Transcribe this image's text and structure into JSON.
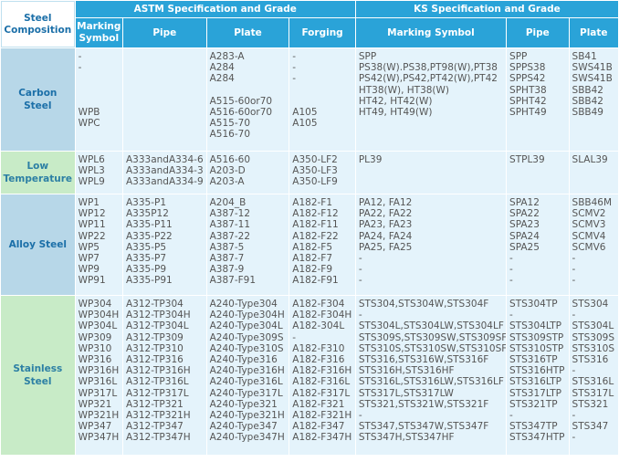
{
  "headers": {
    "composition": "Steel\nComposition",
    "astm_group": "ASTM Specification and Grade",
    "ks_group": "KS Specification and Grade",
    "astm_cols": [
      "Marking\nSymbol",
      "Pipe",
      "Plate",
      "Forging"
    ],
    "ks_cols": [
      "Marking Symbol",
      "Pipe",
      "Plate"
    ]
  },
  "rows": [
    {
      "category": "Carbon\nSteel",
      "cells": [
        "-\n-\n\n\n\nWPB\nWPC",
        "",
        "A283-A\nA284\nA284\n\nA515-60or70\nA516-60or70\nA515-70\nA516-70",
        "-\n-\n-\n\n\nA105\nA105",
        "SPP\nPS38(W).PS38,PT98(W),PT38\nPS42(W),PS42,PT42(W),PT42\nHT38(W), HT38(W)\nHT42, HT42(W)\nHT49, HT49(W)",
        "SPP\nSPPS38\nSPPS42\nSPHT38\nSPHT42\nSPHT49",
        "SB41\nSWS41B\nSWS41B\nSBB42\nSBB42\nSBB49"
      ]
    },
    {
      "category": "Low\nTemperature",
      "cells": [
        "WPL6\nWPL3\nWPL9",
        "A333andA334-6\nA333andA334-3\nA333andA334-9",
        "A516-60\nA203-D\nA203-A",
        "A350-LF2\nA350-LF3\nA350-LF9",
        "PL39",
        "STPL39",
        "SLAL39"
      ]
    },
    {
      "category": "Alloy Steel",
      "cells": [
        "WP1\nWP12\nWP11\nWP22\nWP5\nWP7\nWP9\nWP91",
        "A335-P1\nA335P12\nA335-P11\nA335-P22\nA335-P5\nA335-P7\nA335-P9\nA335-P91",
        "A204_B\nA387-12\nA387-11\nA387-22\nA387-5\nA387-7\nA387-9\nA387-F91",
        "A182-F1\nA182-F12\nA182-F11\nA182-F22\nA182-F5\nA182-F7\nA182-F9\nA182-F91",
        "PA12, FA12\nPA22, FA22\nPA23, FA23\nPA24, FA24\nPA25, FA25\n-\n-\n-",
        "SPA12\nSPA22\nSPA23\nSPA24\nSPA25\n-\n-\n-",
        "SBB46M\nSCMV2\nSCMV3\nSCMV4\nSCMV6\n-\n-\n-"
      ]
    },
    {
      "category": "Stainless\nSteel",
      "cells": [
        "WP304\nWP304H\nWP304L\nWP309\nWP310\nWP316\nWP316H\nWP316L\nWP317L\nWP321\nWP321H\nWP347\nWP347H",
        "A312-TP304\nA312-TP304H\nA312-TP304L\nA312-TP309\nA312-TP310\nA312-TP316\nA312-TP316H\nA312-TP316L\nA312-TP317L\nA312-TP321\nA312-TP321H\nA312-TP347\nA312-TP347H",
        "A240-Type304\nA240-Type304H\nA240-Type304L\nA240-Type309S\nA240-Type310S\nA240-Type316\nA240-Type316H\nA240-Type316L\nA240-Type317L\nA240-Type321\nA240-Type321H\nA240-Type347\nA240-Type347H",
        "A182-F304\nA182-F304H\nA182-304L\n-\nA182-F310\nA182-F316\nA182-F316H\nA182-F316L\nA182-F317L\nA182-F321\nA182-F321H\nA182-F347\nA182-F347H",
        "STS304,STS304W,STS304F\n-\nSTS304L,STS304LW,STS304LF\nSTS309S,STS309SW,STS309SF\nSTS310S,STS310SW,STS310SF\nSTS316,STS316W,STS316F\nSTS316H,STS316HF\nSTS316L,STS316LW,STS316LF\nSTS317L,STS317LW\nSTS321,STS321W,STS321F\n-\nSTS347,STS347W,STS347F\nSTS347H,STS347HF",
        "STS304TP\n-\nSTS304LTP\nSTS309STP\nSTS310STP\nSTS316TP\nSTS316HTP\nSTS316LTP\nSTS317LTP\nSTS321TP\n-\nSTS347TP\nSTS347HTP",
        "STS304\n-\nSTS304L\nSTS309S\nSTS310S\nSTS316\n-\nSTS316L\nSTS317L\nSTS321\n-\nSTS347\n-"
      ]
    }
  ]
}
